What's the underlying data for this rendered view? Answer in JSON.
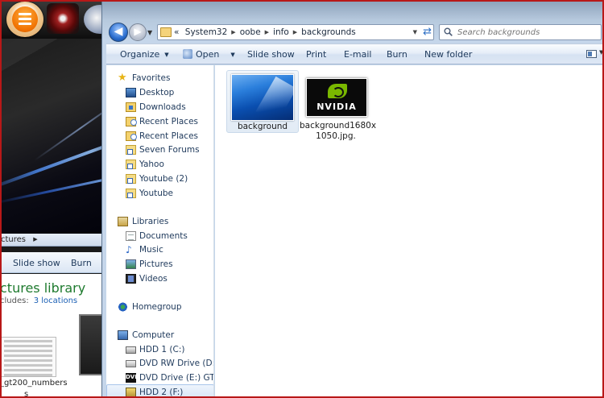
{
  "background_window": {
    "address_text": "ctures",
    "toolbar": {
      "slideshow": "Slide show",
      "burn": "Burn"
    },
    "library_title": "ctures library",
    "includes_label": "cludes:",
    "includes_link": "3 locations",
    "filename_line1": "_gt200_numbers",
    "filename_line2": "s"
  },
  "address_bar": {
    "overflow": "«",
    "path": [
      "System32",
      "oobe",
      "info",
      "backgrounds"
    ]
  },
  "search": {
    "placeholder": "Search backgrounds"
  },
  "command_bar": {
    "organize": "Organize",
    "open": "Open",
    "slideshow": "Slide show",
    "print": "Print",
    "email": "E-mail",
    "burn": "Burn",
    "new_folder": "New folder"
  },
  "nav_pane": {
    "favorites": {
      "header": "Favorites",
      "items": [
        "Desktop",
        "Downloads",
        "Recent Places",
        "Recent Places",
        "Seven Forums",
        "Yahoo",
        "Youtube (2)",
        "Youtube"
      ]
    },
    "libraries": {
      "header": "Libraries",
      "items": [
        "Documents",
        "Music",
        "Pictures",
        "Videos"
      ]
    },
    "homegroup": "Homegroup",
    "computer": {
      "header": "Computer",
      "items": [
        "HDD 1 (C:)",
        "DVD RW Drive (D:) W",
        "DVD Drive (E:) GTA I",
        "HDD 2 (F:)"
      ]
    }
  },
  "files": [
    {
      "name": "background",
      "icon": "image-thumbnail-blue",
      "selected": true
    },
    {
      "name_line1": "background1680x",
      "name_line2": "1050.jpg.",
      "icon": "nvidia-logo-thumbnail"
    }
  ],
  "colors": {
    "frame": "#b81818",
    "library_title": "#1e7a2e",
    "link": "#1a5fb4"
  }
}
